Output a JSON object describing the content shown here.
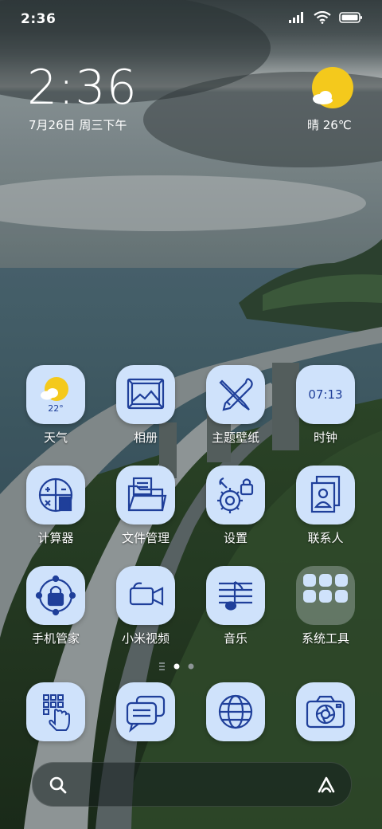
{
  "status_bar": {
    "time": "2:36"
  },
  "clock": {
    "time": "2:36",
    "date": "7月26日 周三下午"
  },
  "weather_widget": {
    "text": "晴 26℃"
  },
  "apps": [
    {
      "label": "天气",
      "icon": "weather-icon",
      "badge": "22°"
    },
    {
      "label": "相册",
      "icon": "gallery-icon"
    },
    {
      "label": "主题壁纸",
      "icon": "themes-icon"
    },
    {
      "label": "时钟",
      "icon": "clock-icon",
      "badge": "07:13"
    },
    {
      "label": "计算器",
      "icon": "calculator-icon"
    },
    {
      "label": "文件管理",
      "icon": "folder-icon"
    },
    {
      "label": "设置",
      "icon": "settings-icon"
    },
    {
      "label": "联系人",
      "icon": "contacts-icon"
    },
    {
      "label": "手机管家",
      "icon": "security-icon"
    },
    {
      "label": "小米视频",
      "icon": "video-camera-icon"
    },
    {
      "label": "音乐",
      "icon": "music-icon"
    },
    {
      "label": "系统工具",
      "icon": "folder-group-icon"
    }
  ],
  "dock": [
    {
      "icon": "phone-dialer-icon"
    },
    {
      "icon": "messages-icon"
    },
    {
      "icon": "browser-icon"
    },
    {
      "icon": "camera-icon"
    }
  ],
  "colors": {
    "icon_bg": "#cfe2fb",
    "icon_stroke": "#1f3f9a",
    "sun": "#f4c91c"
  }
}
